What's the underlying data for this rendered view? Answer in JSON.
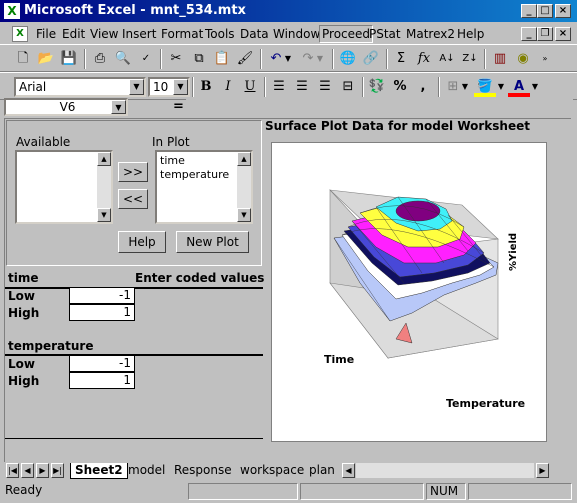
{
  "window": {
    "title": "Microsoft Excel - mnt_534.mtx"
  },
  "menu": [
    "File",
    "Edit",
    "View",
    "Insert",
    "Format",
    "Tools",
    "Data",
    "Window",
    "Proceed",
    "PStat",
    "Matrex2",
    "Help"
  ],
  "menu_active": "Proceed",
  "font": {
    "name": "Arial",
    "size": "10"
  },
  "namebox": "V6",
  "formula_eq": "=",
  "panel": {
    "available_label": "Available",
    "inplot_label": "In Plot",
    "inplot_items": [
      "time",
      "temperature"
    ],
    "add_btn": ">>",
    "remove_btn": "<<",
    "help_btn": "Help",
    "newplot_btn": "New Plot"
  },
  "plot": {
    "title": "Surface Plot Data for model Worksheet",
    "axis_y": "%Yield",
    "axis_time": "Time",
    "axis_temp": "Temperature"
  },
  "factors": [
    {
      "name": "time",
      "header_right": "Enter coded values",
      "low_label": "Low",
      "low": "-1",
      "high_label": "High",
      "high": "1"
    },
    {
      "name": "temperature",
      "header_right": "",
      "low_label": "Low",
      "low": "-1",
      "high_label": "High",
      "high": "1"
    }
  ],
  "tabs": [
    "Sheet2",
    "model",
    "Response",
    "workspace",
    "plan"
  ],
  "status": {
    "ready": "Ready",
    "num": "NUM"
  },
  "colors": {
    "title_start": "#000080",
    "title_end": "#1084d0",
    "face": "#c0c0c0"
  }
}
